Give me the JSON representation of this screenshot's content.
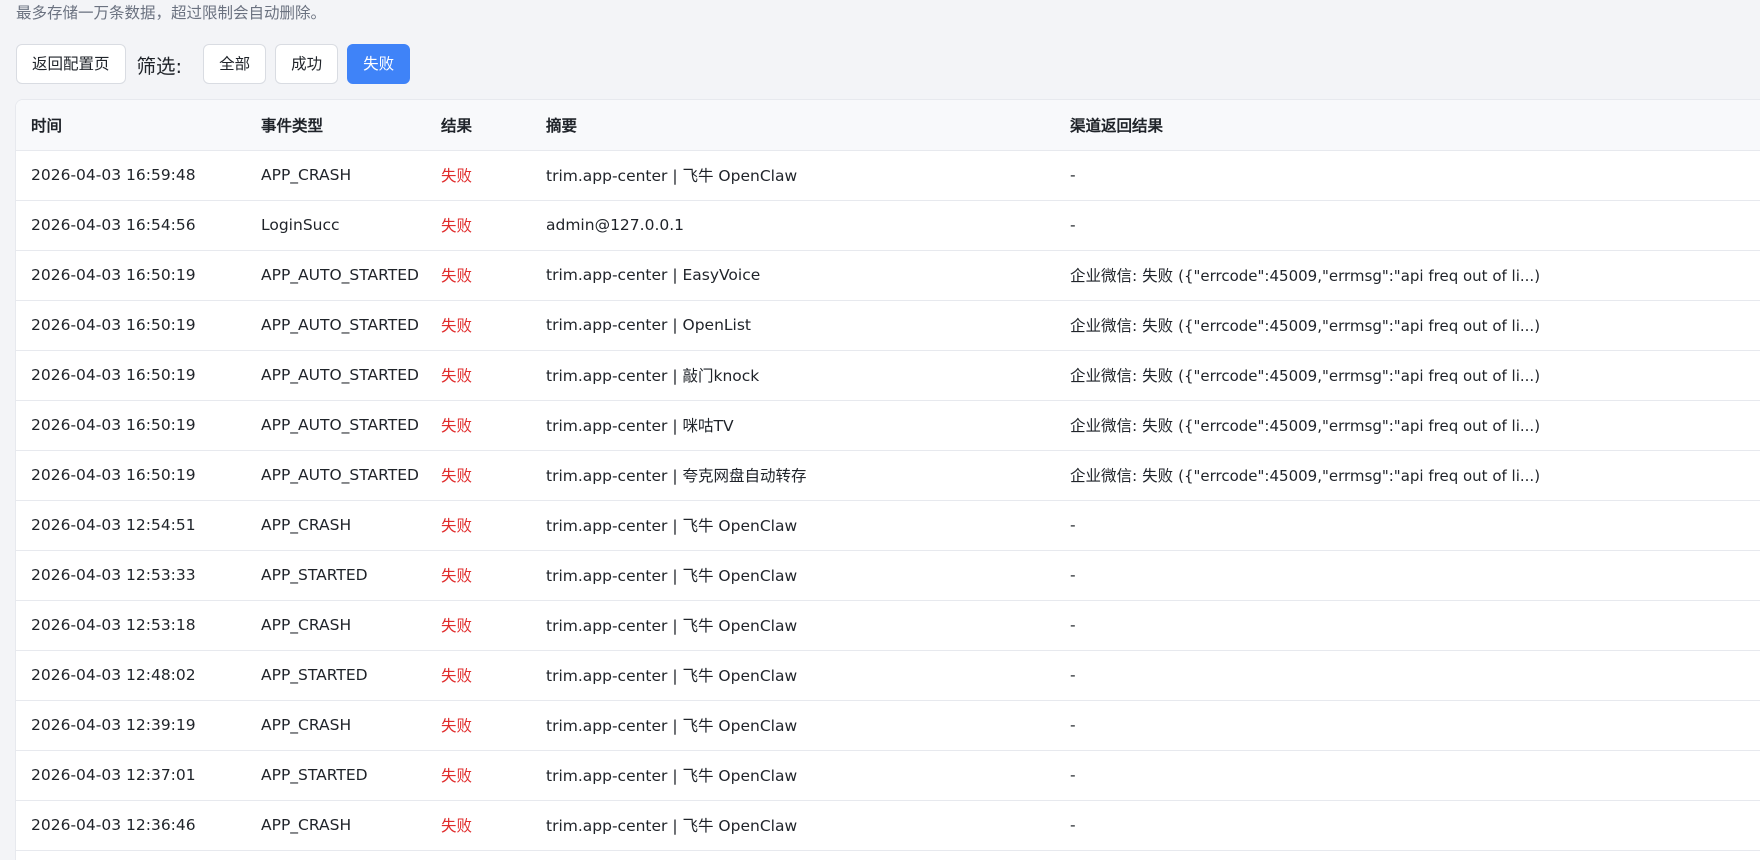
{
  "notice": "最多存储一万条数据，超过限制会自动删除。",
  "toolbar": {
    "back_label": "返回配置页",
    "filter_label": "筛选:",
    "filters": [
      {
        "label": "全部",
        "active": false
      },
      {
        "label": "成功",
        "active": false
      },
      {
        "label": "失败",
        "active": true
      }
    ]
  },
  "table": {
    "headers": [
      "时间",
      "事件类型",
      "结果",
      "摘要",
      "渠道返回结果"
    ],
    "rows": [
      {
        "time": "2026-04-03 16:59:48",
        "type": "APP_CRASH",
        "result": "失败",
        "summary": "trim.app-center | 飞牛 OpenClaw",
        "channel_status": "-",
        "channel_detail": ""
      },
      {
        "time": "2026-04-03 16:54:56",
        "type": "LoginSucc",
        "result": "失败",
        "summary": "admin@127.0.0.1",
        "channel_status": "-",
        "channel_detail": ""
      },
      {
        "time": "2026-04-03 16:50:19",
        "type": "APP_AUTO_STARTED",
        "result": "失败",
        "summary": "trim.app-center | EasyVoice",
        "channel_status": "企业微信: 失败",
        "channel_detail": "({\"errcode\":45009,\"errmsg\":\"api freq out of li...)"
      },
      {
        "time": "2026-04-03 16:50:19",
        "type": "APP_AUTO_STARTED",
        "result": "失败",
        "summary": "trim.app-center | OpenList",
        "channel_status": "企业微信: 失败",
        "channel_detail": "({\"errcode\":45009,\"errmsg\":\"api freq out of li...)"
      },
      {
        "time": "2026-04-03 16:50:19",
        "type": "APP_AUTO_STARTED",
        "result": "失败",
        "summary": "trim.app-center | 敲门knock",
        "channel_status": "企业微信: 失败",
        "channel_detail": "({\"errcode\":45009,\"errmsg\":\"api freq out of li...)"
      },
      {
        "time": "2026-04-03 16:50:19",
        "type": "APP_AUTO_STARTED",
        "result": "失败",
        "summary": "trim.app-center | 咪咕TV",
        "channel_status": "企业微信: 失败",
        "channel_detail": "({\"errcode\":45009,\"errmsg\":\"api freq out of li...)"
      },
      {
        "time": "2026-04-03 16:50:19",
        "type": "APP_AUTO_STARTED",
        "result": "失败",
        "summary": "trim.app-center | 夸克网盘自动转存",
        "channel_status": "企业微信: 失败",
        "channel_detail": "({\"errcode\":45009,\"errmsg\":\"api freq out of li...)"
      },
      {
        "time": "2026-04-03 12:54:51",
        "type": "APP_CRASH",
        "result": "失败",
        "summary": "trim.app-center | 飞牛 OpenClaw",
        "channel_status": "-",
        "channel_detail": ""
      },
      {
        "time": "2026-04-03 12:53:33",
        "type": "APP_STARTED",
        "result": "失败",
        "summary": "trim.app-center | 飞牛 OpenClaw",
        "channel_status": "-",
        "channel_detail": ""
      },
      {
        "time": "2026-04-03 12:53:18",
        "type": "APP_CRASH",
        "result": "失败",
        "summary": "trim.app-center | 飞牛 OpenClaw",
        "channel_status": "-",
        "channel_detail": ""
      },
      {
        "time": "2026-04-03 12:48:02",
        "type": "APP_STARTED",
        "result": "失败",
        "summary": "trim.app-center | 飞牛 OpenClaw",
        "channel_status": "-",
        "channel_detail": ""
      },
      {
        "time": "2026-04-03 12:39:19",
        "type": "APP_CRASH",
        "result": "失败",
        "summary": "trim.app-center | 飞牛 OpenClaw",
        "channel_status": "-",
        "channel_detail": ""
      },
      {
        "time": "2026-04-03 12:37:01",
        "type": "APP_STARTED",
        "result": "失败",
        "summary": "trim.app-center | 飞牛 OpenClaw",
        "channel_status": "-",
        "channel_detail": ""
      },
      {
        "time": "2026-04-03 12:36:46",
        "type": "APP_CRASH",
        "result": "失败",
        "summary": "trim.app-center | 飞牛 OpenClaw",
        "channel_status": "-",
        "channel_detail": ""
      }
    ]
  },
  "colors": {
    "accent": "#3f83f8",
    "fail": "#e02b2b",
    "page_bg": "#f3f4f7"
  }
}
